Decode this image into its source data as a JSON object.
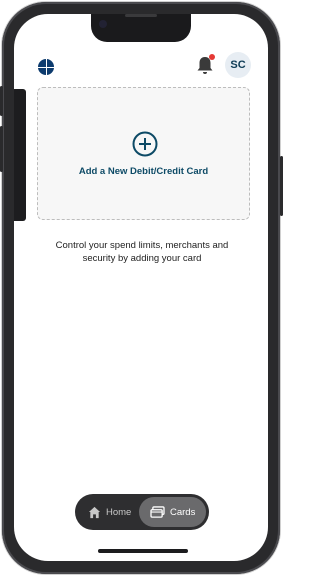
{
  "header": {
    "avatar_initials": "SC"
  },
  "add_card": {
    "label": "Add a New Debit/Credit Card"
  },
  "helper_text": "Control your spend limits, merchants and security by adding your card",
  "nav": {
    "home_label": "Home",
    "cards_label": "Cards",
    "active": "Cards"
  },
  "colors": {
    "accent": "#0d4a66",
    "notification_dot": "#e53935",
    "nav_bg": "#2e2e30",
    "nav_active": "#6a6a6c"
  },
  "icons": [
    "app-logo-icon",
    "bell-icon",
    "plus-circle-icon",
    "home-icon",
    "cards-icon"
  ]
}
